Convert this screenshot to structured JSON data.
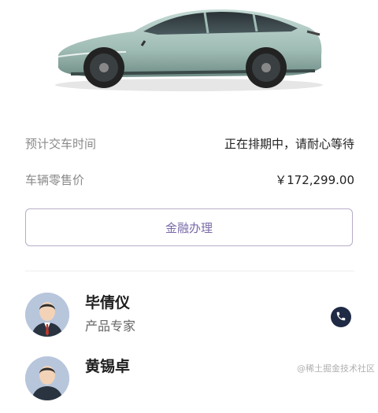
{
  "delivery": {
    "label": "预计交车时间",
    "value": "正在排期中，请耐心等待"
  },
  "price": {
    "label": "车辆零售价",
    "value": "￥172,299.00"
  },
  "finance_button": {
    "label": "金融办理"
  },
  "contacts": [
    {
      "name": "毕倩仪",
      "role": "产品专家",
      "icon": "phone-icon"
    },
    {
      "name": "黄锡卓",
      "role": "",
      "icon": ""
    }
  ],
  "watermark": "@稀土掘金技术社区",
  "colors": {
    "accent": "#7a6aa8",
    "button_border": "#b6adc9",
    "phone_bg": "#1f2a44",
    "car_body": "#a9c4bd"
  }
}
